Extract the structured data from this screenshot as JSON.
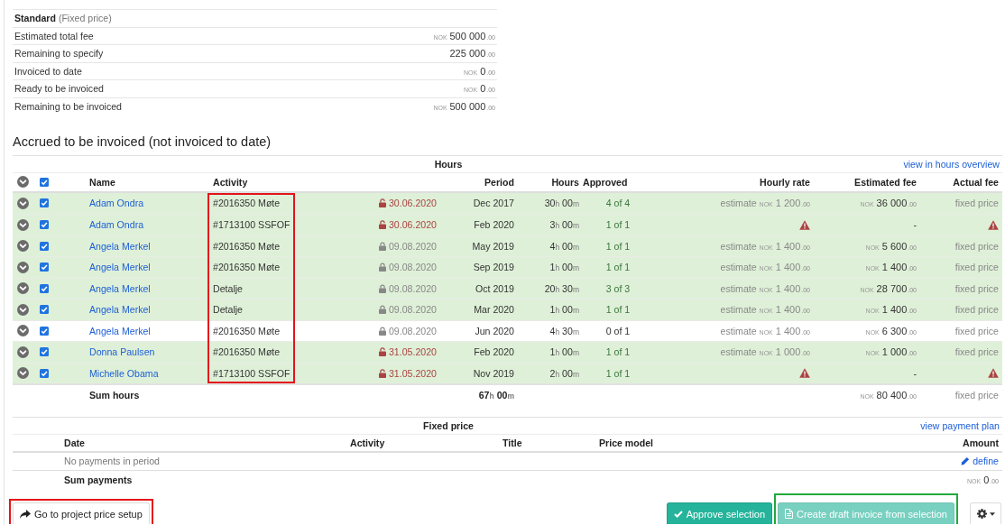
{
  "summary": {
    "rows": [
      {
        "kind": "heading",
        "label": "Standard",
        "note": "(Fixed price)"
      },
      {
        "kind": "value",
        "label": "Estimated total fee",
        "value": {
          "currency": "NOK",
          "amount": "500 000",
          "cents": ".00"
        }
      },
      {
        "kind": "value",
        "label": "Remaining to specify",
        "value": {
          "amount": "225 000",
          "cents": ".00"
        }
      },
      {
        "kind": "value",
        "label": "Invoiced to date",
        "value": {
          "currency": "NOK",
          "amount": "0",
          "cents": ".00"
        }
      },
      {
        "kind": "value",
        "label": "Ready to be invoiced",
        "value": {
          "currency": "NOK",
          "amount": "0",
          "cents": ".00"
        }
      },
      {
        "kind": "value",
        "label": "Remaining to be invoiced",
        "value": {
          "currency": "NOK",
          "amount": "500 000",
          "cents": ".00"
        }
      }
    ]
  },
  "section_title": "Accrued to be invoiced (not invoiced to date)",
  "hours_table": {
    "group_title": "Hours",
    "link": "view in hours overview",
    "select_all": {
      "selected": true
    },
    "columns": [
      {
        "label": "Name"
      },
      {
        "label": "Activity",
        "frame": {
          "color": "#e3141c"
        }
      },
      {
        "label": "Period"
      },
      {
        "label": "Hours"
      },
      {
        "label": "Approved"
      },
      {
        "label": "Hourly rate"
      },
      {
        "label": "Estimated fee"
      },
      {
        "label": "Actual fee"
      }
    ],
    "rows": [
      {
        "selected": true,
        "approved": true,
        "name": "Adam Ondra",
        "activity": "#2016350 Møte",
        "locked": false,
        "date": "30.06.2020",
        "period": "Dec 2017",
        "hours": [
          "30",
          "h",
          "00",
          "m"
        ],
        "approved_count": "4 of 4",
        "hourly_rate": {
          "kind": "money",
          "prefix": "estimate",
          "currency": "NOK",
          "amount": "1 200",
          "cents": ".00"
        },
        "estimated_fee": {
          "kind": "money",
          "currency": "NOK",
          "amount": "36 000",
          "cents": ".00"
        },
        "actual_fee": {
          "kind": "text",
          "text": "fixed price"
        }
      },
      {
        "selected": true,
        "approved": true,
        "name": "Adam Ondra",
        "activity": "#1713100 SSFOF",
        "locked": false,
        "date": "30.06.2020",
        "period": "Feb 2020",
        "hours": [
          "3",
          "h",
          "00",
          "m"
        ],
        "approved_count": "1 of 1",
        "hourly_rate": {
          "kind": "warning"
        },
        "estimated_fee": {
          "kind": "text",
          "text": "-"
        },
        "actual_fee": {
          "kind": "warning"
        }
      },
      {
        "selected": true,
        "approved": true,
        "name": "Angela Merkel",
        "activity": "#2016350 Møte",
        "locked": true,
        "date": "09.08.2020",
        "period": "May 2019",
        "hours": [
          "4",
          "h",
          "00",
          "m"
        ],
        "approved_count": "1 of 1",
        "hourly_rate": {
          "kind": "money",
          "prefix": "estimate",
          "currency": "NOK",
          "amount": "1 400",
          "cents": ".00"
        },
        "estimated_fee": {
          "kind": "money",
          "currency": "NOK",
          "amount": "5 600",
          "cents": ".00"
        },
        "actual_fee": {
          "kind": "text",
          "text": "fixed price"
        }
      },
      {
        "selected": true,
        "approved": true,
        "name": "Angela Merkel",
        "activity": "#2016350 Møte",
        "locked": true,
        "date": "09.08.2020",
        "period": "Sep 2019",
        "hours": [
          "1",
          "h",
          "00",
          "m"
        ],
        "approved_count": "1 of 1",
        "hourly_rate": {
          "kind": "money",
          "prefix": "estimate",
          "currency": "NOK",
          "amount": "1 400",
          "cents": ".00"
        },
        "estimated_fee": {
          "kind": "money",
          "currency": "NOK",
          "amount": "1 400",
          "cents": ".00"
        },
        "actual_fee": {
          "kind": "text",
          "text": "fixed price"
        }
      },
      {
        "selected": true,
        "approved": true,
        "name": "Angela Merkel",
        "activity": "Detalje",
        "locked": true,
        "date": "09.08.2020",
        "period": "Oct 2019",
        "hours": [
          "20",
          "h",
          "30",
          "m"
        ],
        "approved_count": "3 of 3",
        "hourly_rate": {
          "kind": "money",
          "prefix": "estimate",
          "currency": "NOK",
          "amount": "1 400",
          "cents": ".00"
        },
        "estimated_fee": {
          "kind": "money",
          "currency": "NOK",
          "amount": "28 700",
          "cents": ".00"
        },
        "actual_fee": {
          "kind": "text",
          "text": "fixed price"
        }
      },
      {
        "selected": true,
        "approved": true,
        "name": "Angela Merkel",
        "activity": "Detalje",
        "locked": true,
        "date": "09.08.2020",
        "period": "Mar 2020",
        "hours": [
          "1",
          "h",
          "00",
          "m"
        ],
        "approved_count": "1 of 1",
        "hourly_rate": {
          "kind": "money",
          "prefix": "estimate",
          "currency": "NOK",
          "amount": "1 400",
          "cents": ".00"
        },
        "estimated_fee": {
          "kind": "money",
          "currency": "NOK",
          "amount": "1 400",
          "cents": ".00"
        },
        "actual_fee": {
          "kind": "text",
          "text": "fixed price"
        }
      },
      {
        "selected": true,
        "approved": false,
        "name": "Angela Merkel",
        "activity": "#2016350 Møte",
        "locked": true,
        "date": "09.08.2020",
        "period": "Jun 2020",
        "hours": [
          "4",
          "h",
          "30",
          "m"
        ],
        "approved_count": "0 of 1",
        "hourly_rate": {
          "kind": "money",
          "prefix": "estimate",
          "currency": "NOK",
          "amount": "1 400",
          "cents": ".00"
        },
        "estimated_fee": {
          "kind": "money",
          "currency": "NOK",
          "amount": "6 300",
          "cents": ".00"
        },
        "actual_fee": {
          "kind": "text",
          "text": "fixed price"
        }
      },
      {
        "selected": true,
        "approved": true,
        "name": "Donna Paulsen",
        "activity": "#2016350 Møte",
        "locked": false,
        "date": "31.05.2020",
        "period": "Feb 2020",
        "hours": [
          "1",
          "h",
          "00",
          "m"
        ],
        "approved_count": "1 of 1",
        "hourly_rate": {
          "kind": "money",
          "prefix": "estimate",
          "currency": "NOK",
          "amount": "1 000",
          "cents": ".00"
        },
        "estimated_fee": {
          "kind": "money",
          "currency": "NOK",
          "amount": "1 000",
          "cents": ".00"
        },
        "actual_fee": {
          "kind": "text",
          "text": "fixed price"
        }
      },
      {
        "selected": true,
        "approved": true,
        "name": "Michelle Obama",
        "activity": "#1713100 SSFOF",
        "locked": false,
        "date": "31.05.2020",
        "period": "Nov 2019",
        "hours": [
          "2",
          "h",
          "00",
          "m"
        ],
        "approved_count": "1 of 1",
        "hourly_rate": {
          "kind": "warning"
        },
        "estimated_fee": {
          "kind": "text",
          "text": "-"
        },
        "actual_fee": {
          "kind": "warning"
        }
      }
    ],
    "sum": {
      "label": "Sum hours",
      "hours": [
        "67",
        "h",
        "00",
        "m"
      ],
      "estimated_fee": {
        "kind": "money",
        "currency": "NOK",
        "amount": "80 400",
        "cents": ".00"
      },
      "actual_fee": {
        "kind": "text",
        "text": "fixed price"
      }
    }
  },
  "fixed_price_table": {
    "group_title": "Fixed price",
    "link": "view payment plan",
    "columns": [
      "Date",
      "Activity",
      "Title",
      "Price model",
      "Amount"
    ],
    "empty_text": "No payments in period",
    "define_link": "define",
    "sum": {
      "label": "Sum payments",
      "amount": {
        "currency": "NOK",
        "amount": "0",
        "cents": ".00"
      }
    }
  },
  "buttons": [
    {
      "kind": "setup",
      "label": "Go to project price setup",
      "disabled": false,
      "frame": {
        "color": "#e3141c"
      }
    },
    {
      "kind": "approve",
      "label": "Approve selection",
      "disabled": false
    },
    {
      "kind": "invoice",
      "label": "Create draft invoice from selection",
      "disabled": true,
      "frame": {
        "color": "#22a83a"
      }
    },
    {
      "kind": "menu",
      "disabled": false
    }
  ]
}
